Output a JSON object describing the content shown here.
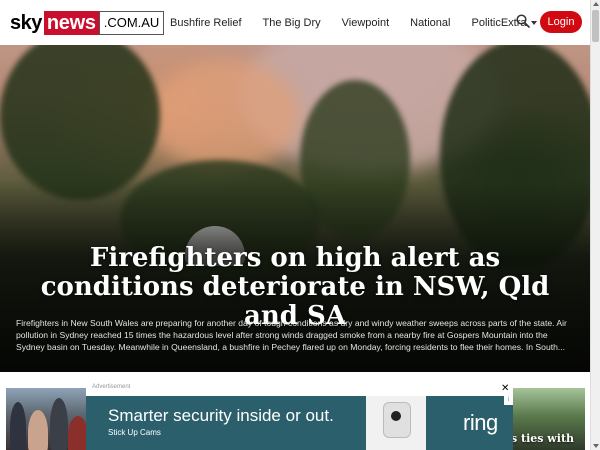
{
  "logo": {
    "part1": "sky",
    "part2": "news",
    "part3": ".COM.AU"
  },
  "nav": {
    "items": [
      "Bushfire Relief",
      "The Big Dry",
      "Viewpoint",
      "National",
      "PoliticExtra"
    ],
    "login_label": "Login"
  },
  "hero": {
    "headline": "Firefighters on high alert as conditions deteriorate in NSW, Qld and SA",
    "summary": "Firefighters in New South Wales are preparing for another day of tough conditions as dry and windy weather sweeps across parts of the state. Air pollution in Sydney reached 15 times the hazardous level after strong winds dragged smoke from a nearby fire at Gospers Mountain into the Sydney basin on Tuesday. Meanwhile in Queensland, a bushfire in Pechey flared up on Monday, forcing residents to flee their homes. In South..."
  },
  "ad": {
    "label": "Advertisement",
    "close": "✕",
    "info": "i",
    "headline": "Smarter security inside or out.",
    "subline": "Stick Up Cams",
    "brand": "ring"
  },
  "teaser_right": {
    "text": "s ties with"
  },
  "colors": {
    "accent": "#d10a11",
    "brand_red": "#c8102e",
    "ad_bg": "#2c5f6c"
  },
  "icons": {
    "search": "search-icon",
    "dropdown": "chevron-down-icon",
    "close": "close-icon"
  }
}
